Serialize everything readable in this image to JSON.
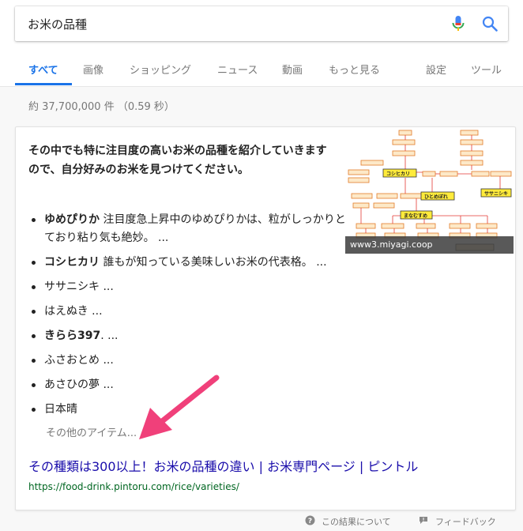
{
  "search": {
    "query": "お米の品種"
  },
  "tabs": [
    {
      "label": "すべて"
    },
    {
      "label": "画像"
    },
    {
      "label": "ショッピング"
    },
    {
      "label": "ニュース"
    },
    {
      "label": "動画"
    },
    {
      "label": "もっと見る"
    },
    {
      "label": "設定"
    },
    {
      "label": "ツール"
    }
  ],
  "stats": {
    "text": "約 37,700,000 件 （0.59 秒）"
  },
  "snippet": {
    "lead": "その中でも特に注目度の高いお米の品種を紹介していきますので、自分好みのお米を見つけてください。",
    "items": [
      {
        "bold": "ゆめぴりか",
        "text": " 注目度急上昇中のゆめぴりかは、粒がしっかりとしており粘り気も絶妙。 ..."
      },
      {
        "bold": "コシヒカリ",
        "text": " 誰もが知っている美味しいお米の代表格。 ..."
      },
      {
        "bold": "",
        "text": "ササニシキ ..."
      },
      {
        "bold": "",
        "text": "はえぬき ..."
      },
      {
        "bold": "きらら397",
        "text": ". ..."
      },
      {
        "bold": "",
        "text": "ふさおとめ ..."
      },
      {
        "bold": "",
        "text": "あさひの夢 ..."
      },
      {
        "bold": "",
        "text": "日本晴"
      }
    ],
    "more": "その他のアイテム..."
  },
  "result": {
    "title": "その種類は300以上！お米の品種の違い | お米専門ページ | ピントル",
    "url": "https://food-drink.pintoru.com/rice/varieties/"
  },
  "thumbnail": {
    "caption": "www3.miyagi.coop",
    "boxes": [
      "コシヒカリ",
      "ひとめぼれ",
      "ササニシキ",
      "まなむすめ"
    ]
  },
  "footer": {
    "about": "この結果について",
    "feedback": "フィードバック"
  },
  "colors": {
    "accent": "#1a73e8",
    "link": "#1a0dab",
    "url": "#006621",
    "arrow": "#f0407a"
  }
}
